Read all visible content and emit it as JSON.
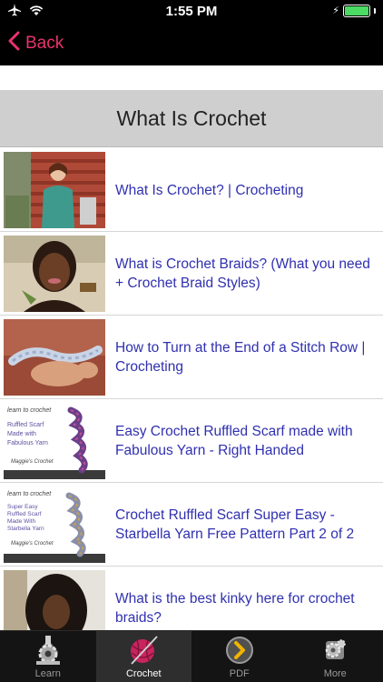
{
  "status_bar": {
    "time": "1:55 PM",
    "icons": [
      "airplane-icon",
      "wifi-icon",
      "battery-charging-icon"
    ],
    "battery_level": 1.0
  },
  "nav": {
    "back_label": "Back",
    "accent_color": "#e8336e"
  },
  "section": {
    "title": "What Is Crochet"
  },
  "videos": [
    {
      "title": "What Is Crochet? | Crocheting"
    },
    {
      "title": "What is Crochet Braids? (What you need + Crochet Braid Styles)"
    },
    {
      "title": "How to Turn at the End of a Stitch Row | Crocheting"
    },
    {
      "title": "Easy Crochet Ruffled Scarf made with Fabulous Yarn - Right Handed",
      "thumb_text": [
        "learn to crochet",
        "Ruffled Scarf",
        "Made with",
        "Fabulous Yarn",
        "Maggie's Crochet"
      ]
    },
    {
      "title": "Crochet Ruffled Scarf Super Easy - Starbella Yarn Free Pattern Part 2 of 2",
      "thumb_text": [
        "learn to crochet",
        "Super Easy",
        "Ruffled Scarf",
        "Made With",
        "Starbella Yarn",
        "Maggie's Crochet"
      ]
    },
    {
      "title": "What is the best kinky here for crochet braids?"
    }
  ],
  "tabs": [
    {
      "label": "Learn",
      "icon": "gear-icon",
      "active": false
    },
    {
      "label": "Crochet",
      "icon": "yarn-ball-icon",
      "active": true
    },
    {
      "label": "PDF",
      "icon": "chevron-right-circle-icon",
      "active": false
    },
    {
      "label": "More",
      "icon": "gear-more-icon",
      "active": false
    }
  ]
}
